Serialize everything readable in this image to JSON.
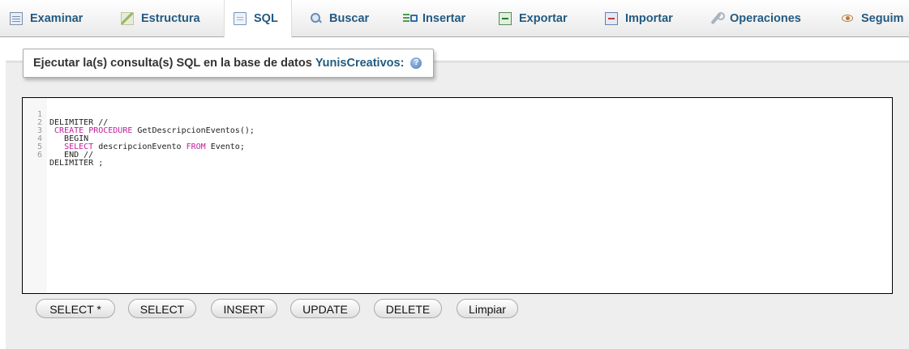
{
  "tabs": [
    {
      "label": "Examinar",
      "icon": "browse-icon"
    },
    {
      "label": "Estructura",
      "icon": "structure-icon"
    },
    {
      "label": "SQL",
      "icon": "sql-icon",
      "active": true
    },
    {
      "label": "Buscar",
      "icon": "search-icon"
    },
    {
      "label": "Insertar",
      "icon": "insert-icon"
    },
    {
      "label": "Exportar",
      "icon": "export-icon"
    },
    {
      "label": "Importar",
      "icon": "import-icon"
    },
    {
      "label": "Operaciones",
      "icon": "operations-icon"
    },
    {
      "label": "Seguim",
      "icon": "tracking-icon"
    }
  ],
  "query_panel": {
    "legend_prefix": "Ejecutar la(s) consulta(s) SQL en la base de datos ",
    "database": "YunisCreativos:",
    "help_icon": "help-icon"
  },
  "editor": {
    "lines": [
      {
        "num": "1",
        "text": "DELIMITER //"
      },
      {
        "num": "2",
        "text": " CREATE PROCEDURE GetDescripcionEventos();"
      },
      {
        "num": "3",
        "text": "   BEGIN"
      },
      {
        "num": "4",
        "text": "   SELECT descripcionEvento FROM Evento;"
      },
      {
        "num": "5",
        "text": "   END //"
      },
      {
        "num": "6",
        "text": "DELIMITER ;"
      }
    ]
  },
  "buttons": [
    "SELECT *",
    "SELECT",
    "INSERT",
    "UPDATE",
    "DELETE",
    "Limpiar"
  ],
  "colors": {
    "link": "#235a81",
    "keyword": "#c0209d",
    "background_panel": "#eeeeee"
  }
}
